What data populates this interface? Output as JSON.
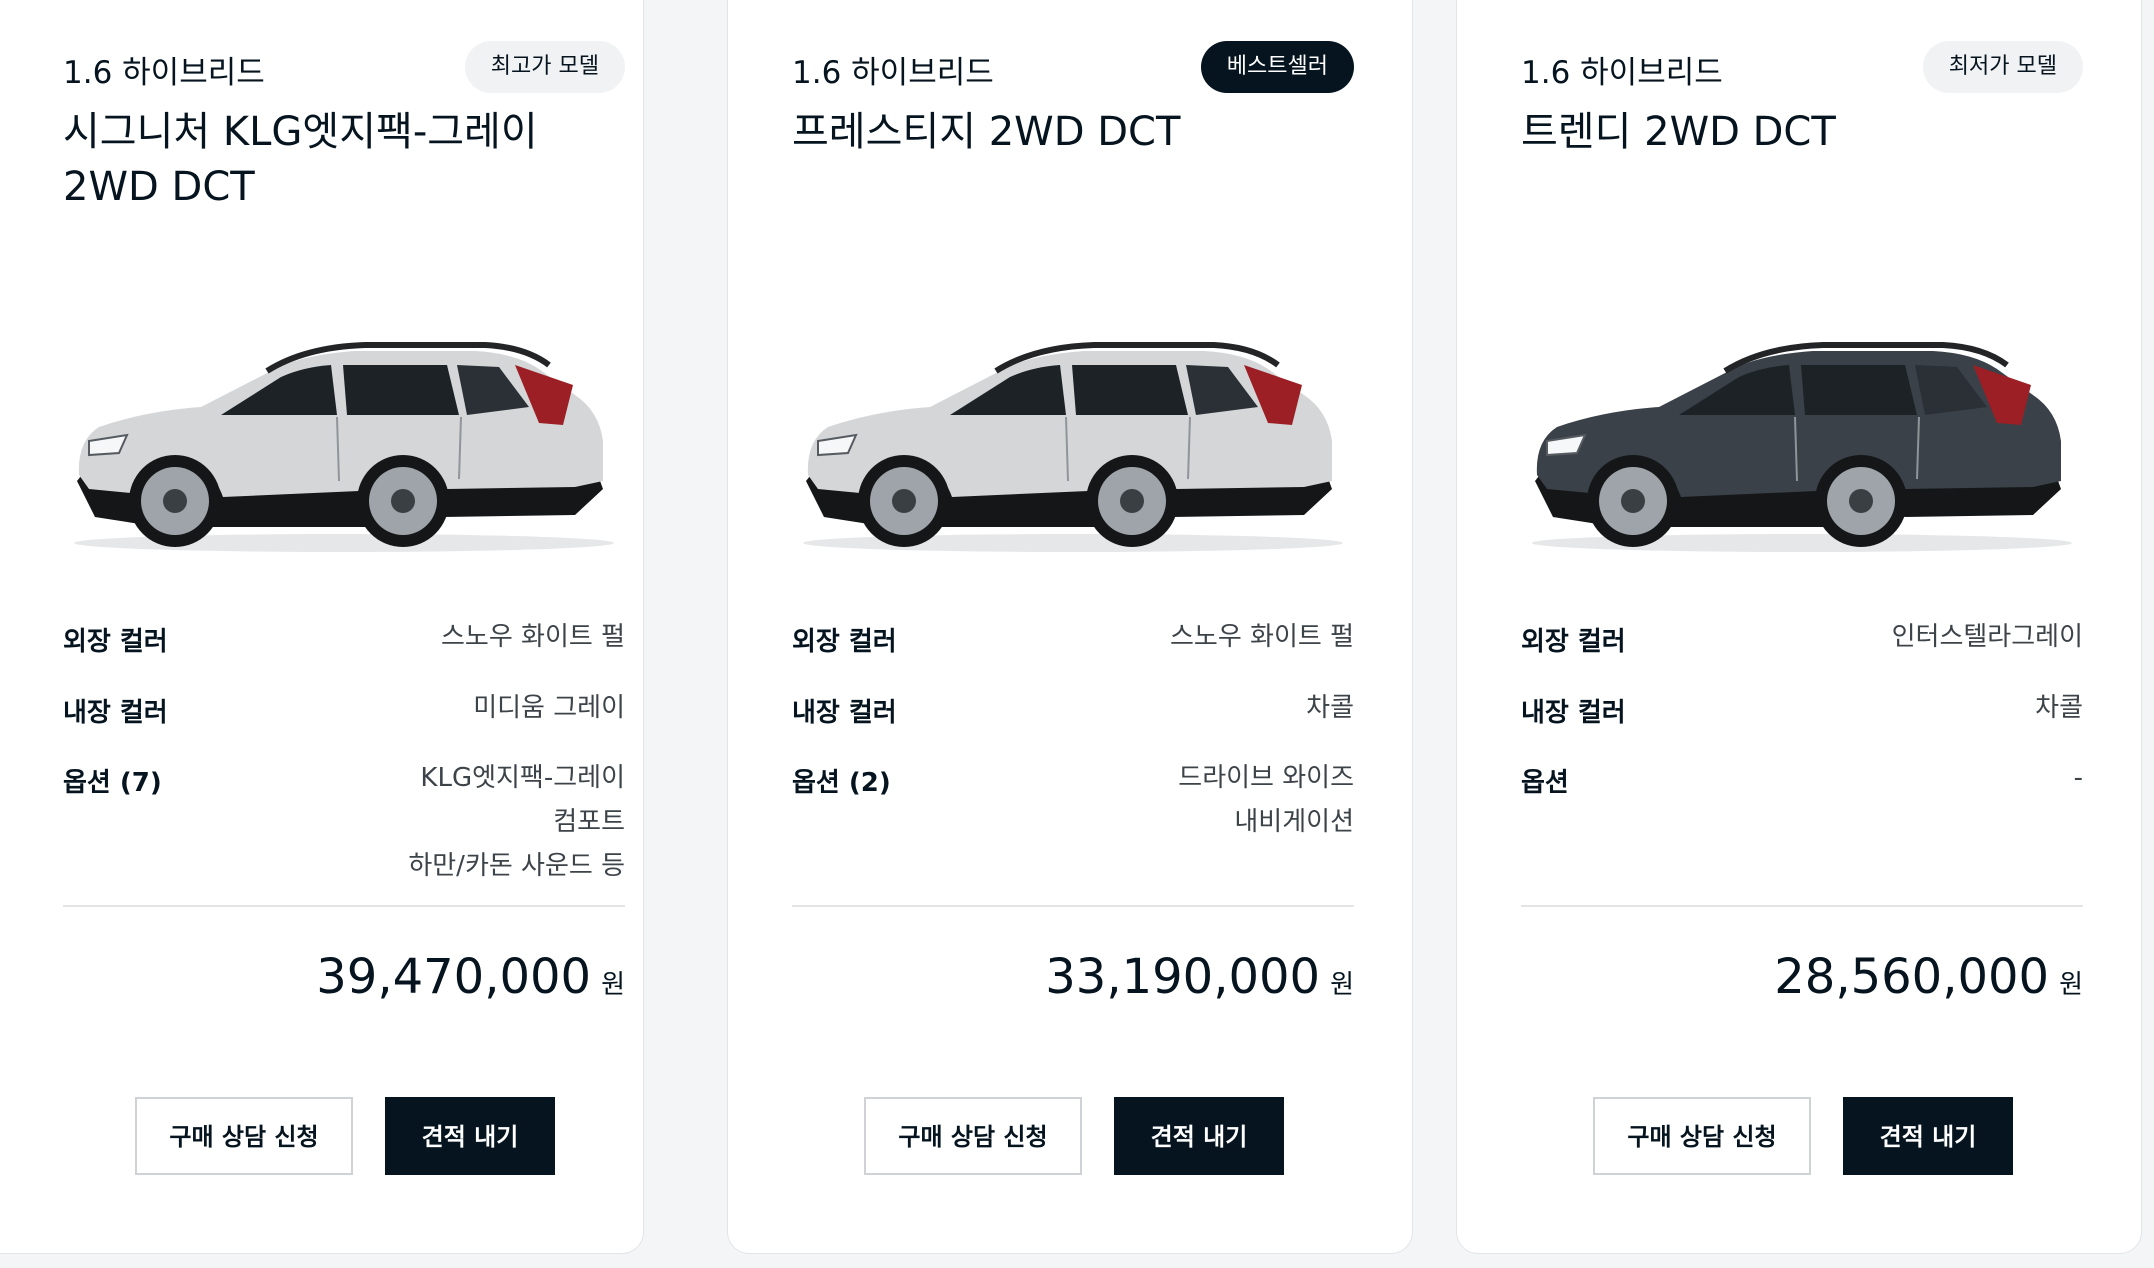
{
  "cards": [
    {
      "engine": "1.6 하이브리드",
      "badge": "최고가 모델",
      "trim": "시그니처 KLG엣지팩-그레이 2WD DCT",
      "car_color": "#d4d6d8",
      "exterior_label": "외장 컬러",
      "exterior_value": "스노우 화이트 펄",
      "interior_label": "내장 컬러",
      "interior_value": "미디움 그레이",
      "options_label": "옵션 (7)",
      "options": [
        "KLG엣지팩-그레이",
        "컴포트",
        "하만/카돈 사운드 등"
      ],
      "price": "39,470,000",
      "price_unit": "원",
      "consult_button": "구매 상담 신청",
      "quote_button": "견적 내기"
    },
    {
      "engine": "1.6 하이브리드",
      "badge": "베스트셀러",
      "trim": "프레스티지 2WD DCT",
      "car_color": "#d4d6d8",
      "exterior_label": "외장 컬러",
      "exterior_value": "스노우 화이트 펄",
      "interior_label": "내장 컬러",
      "interior_value": "차콜",
      "options_label": "옵션 (2)",
      "options": [
        "드라이브 와이즈",
        "내비게이션"
      ],
      "price": "33,190,000",
      "price_unit": "원",
      "consult_button": "구매 상담 신청",
      "quote_button": "견적 내기"
    },
    {
      "engine": "1.6 하이브리드",
      "badge": "최저가 모델",
      "trim": "트렌디 2WD DCT",
      "car_color": "#3a4148",
      "exterior_label": "외장 컬러",
      "exterior_value": "인터스텔라그레이",
      "interior_label": "내장 컬러",
      "interior_value": "차콜",
      "options_label": "옵션",
      "options": [
        "-"
      ],
      "price": "28,560,000",
      "price_unit": "원",
      "consult_button": "구매 상담 신청",
      "quote_button": "견적 내기"
    }
  ]
}
